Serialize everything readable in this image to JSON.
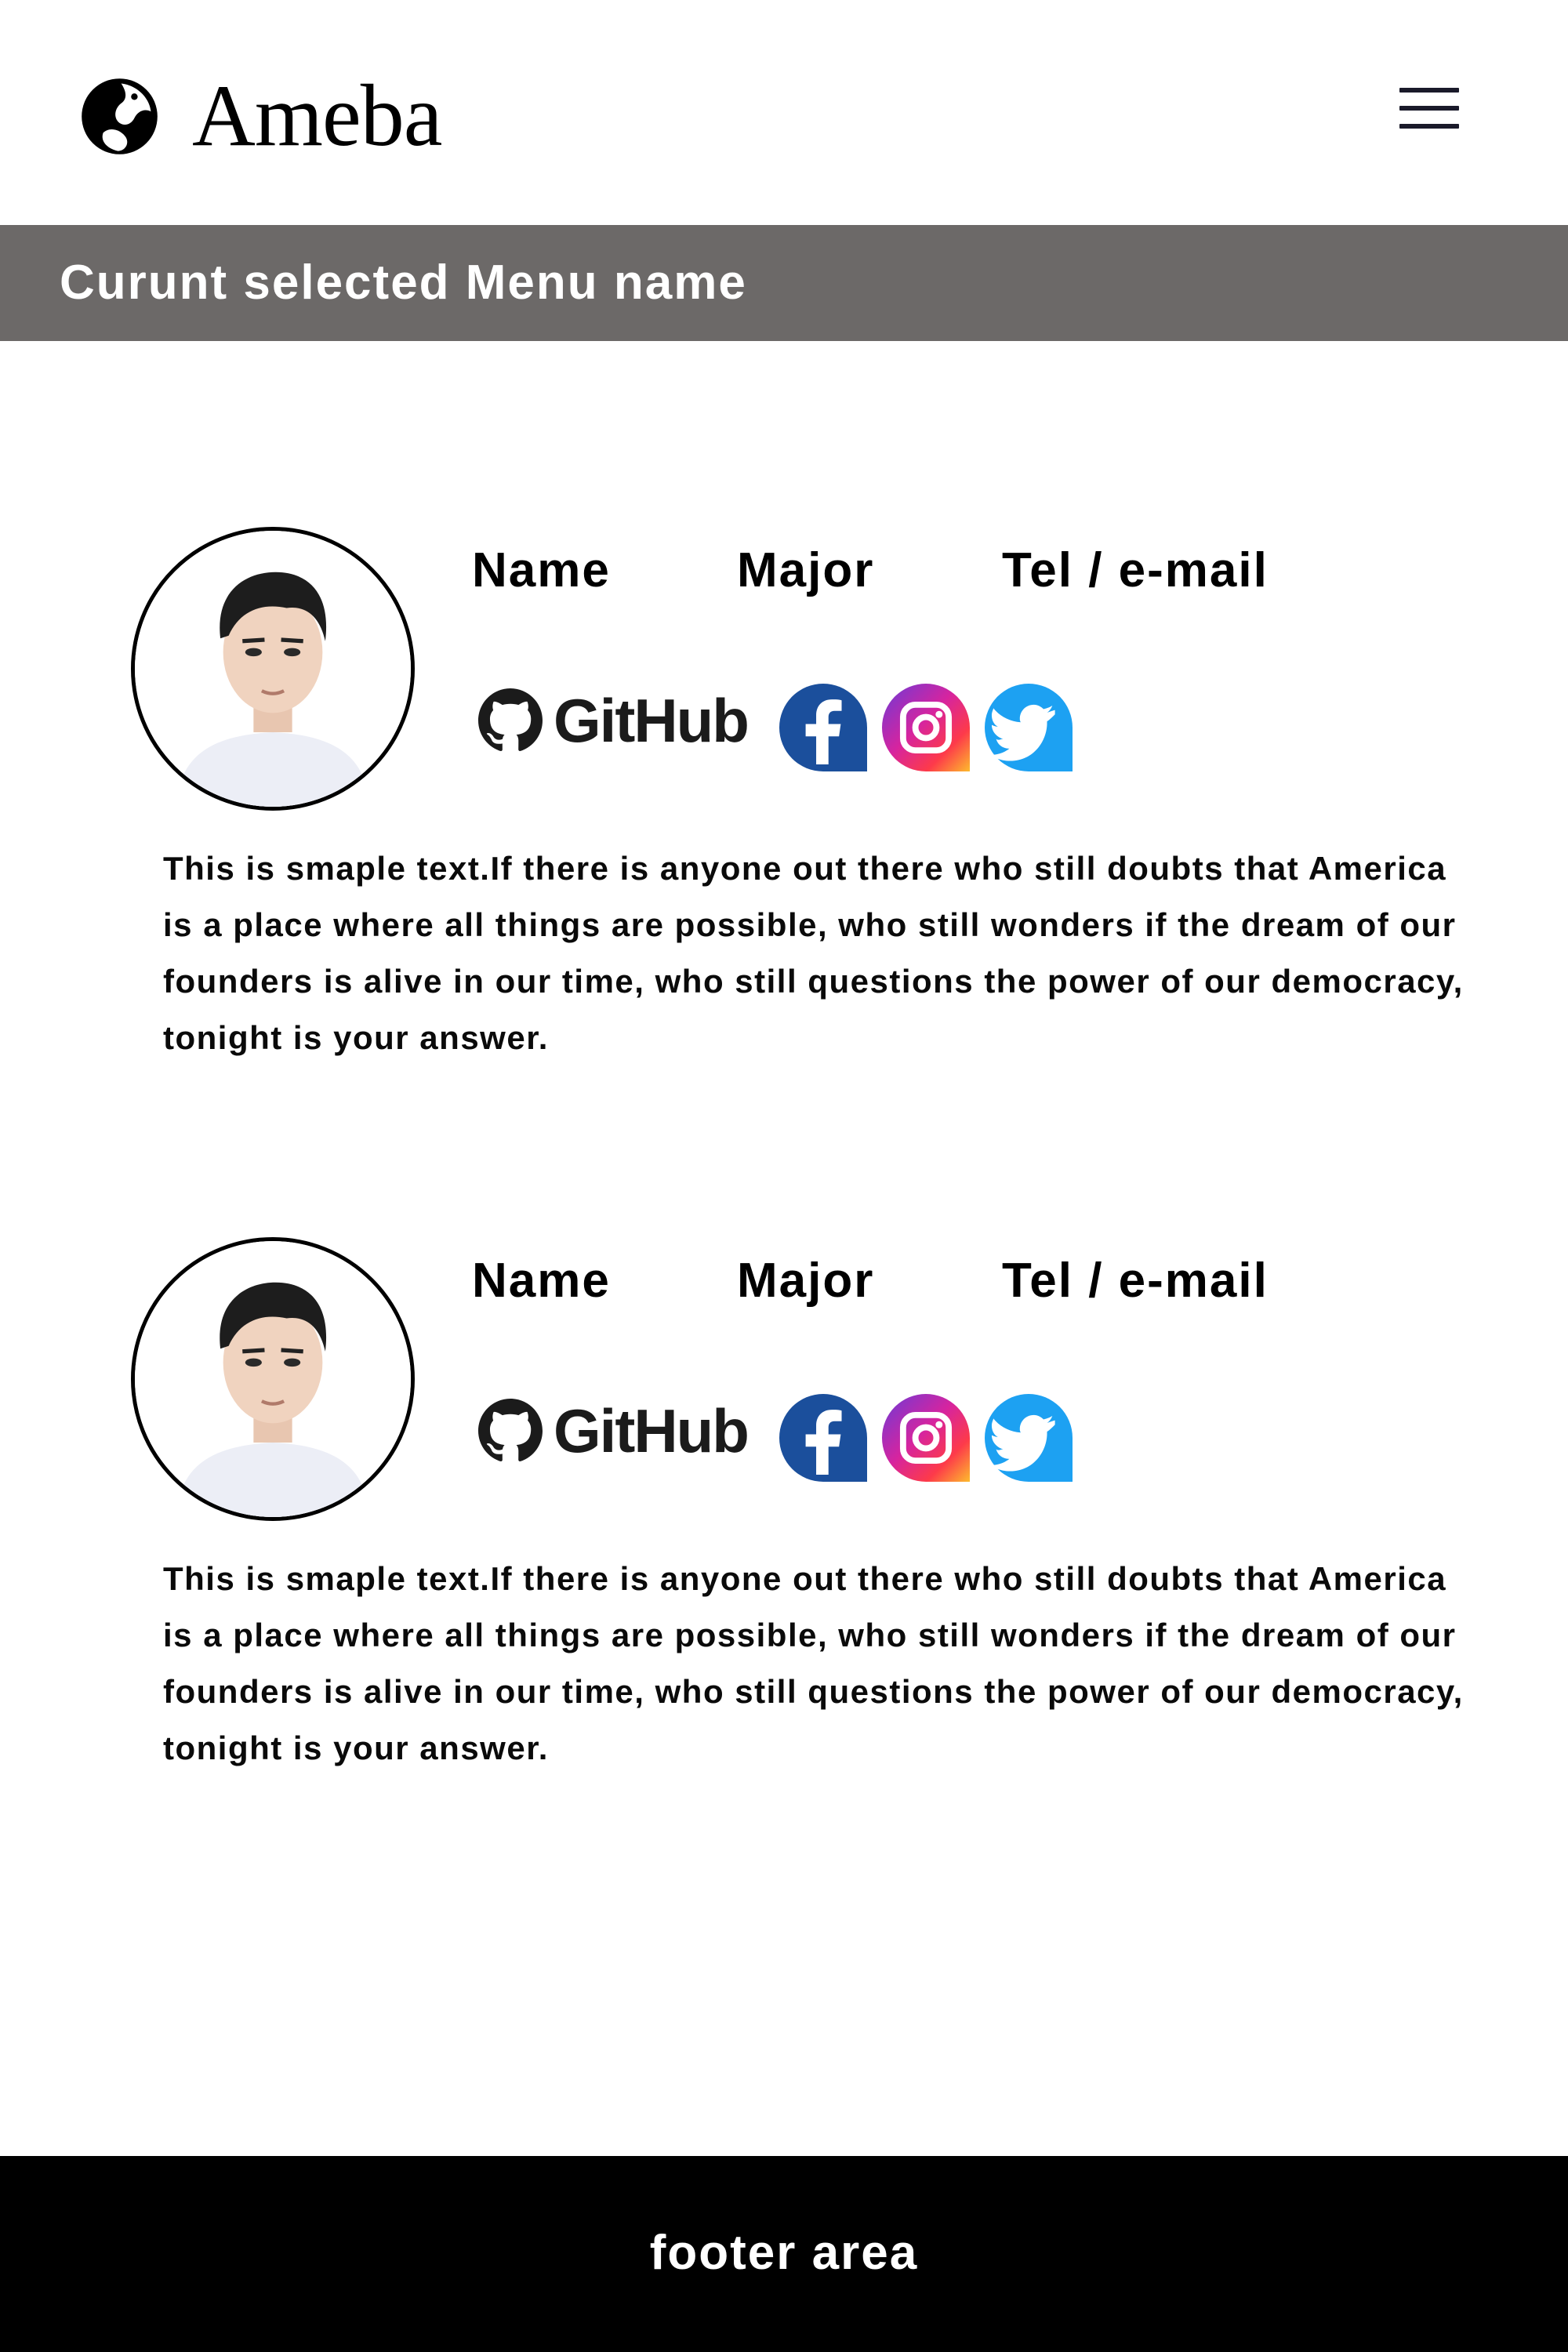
{
  "header": {
    "logo_text": "Ameba",
    "logo_icon": "ameba-logo-icon",
    "menu_icon": "hamburger-menu-icon"
  },
  "menu_bar": {
    "title": "Curunt selected Menu name",
    "background": "#6c6968"
  },
  "profiles": [
    {
      "name_label": "Name",
      "major_label": "Major",
      "contact_label": "Tel / e-mail",
      "github_label": "GitHub",
      "bio": "This is smaple text.If there is anyone out there who still doubts that America is a place where all things are possible, who still wonders if the dream of our founders is alive in our time, who still questions the power of our democracy, tonight is your answer."
    },
    {
      "name_label": "Name",
      "major_label": "Major",
      "contact_label": "Tel / e-mail",
      "github_label": "GitHub",
      "bio": "This is smaple text.If there is anyone out there who still doubts that America is a place where all things are possible, who still wonders if the dream of our founders is alive in our time, who still questions the power of our democracy, tonight is your answer."
    }
  ],
  "social_icons": [
    "github-icon",
    "facebook-icon",
    "instagram-icon",
    "twitter-icon"
  ],
  "colors": {
    "facebook": "#1b4f9c",
    "twitter": "#1da1f2",
    "footer": "#000000"
  },
  "footer": {
    "text": "footer area"
  }
}
